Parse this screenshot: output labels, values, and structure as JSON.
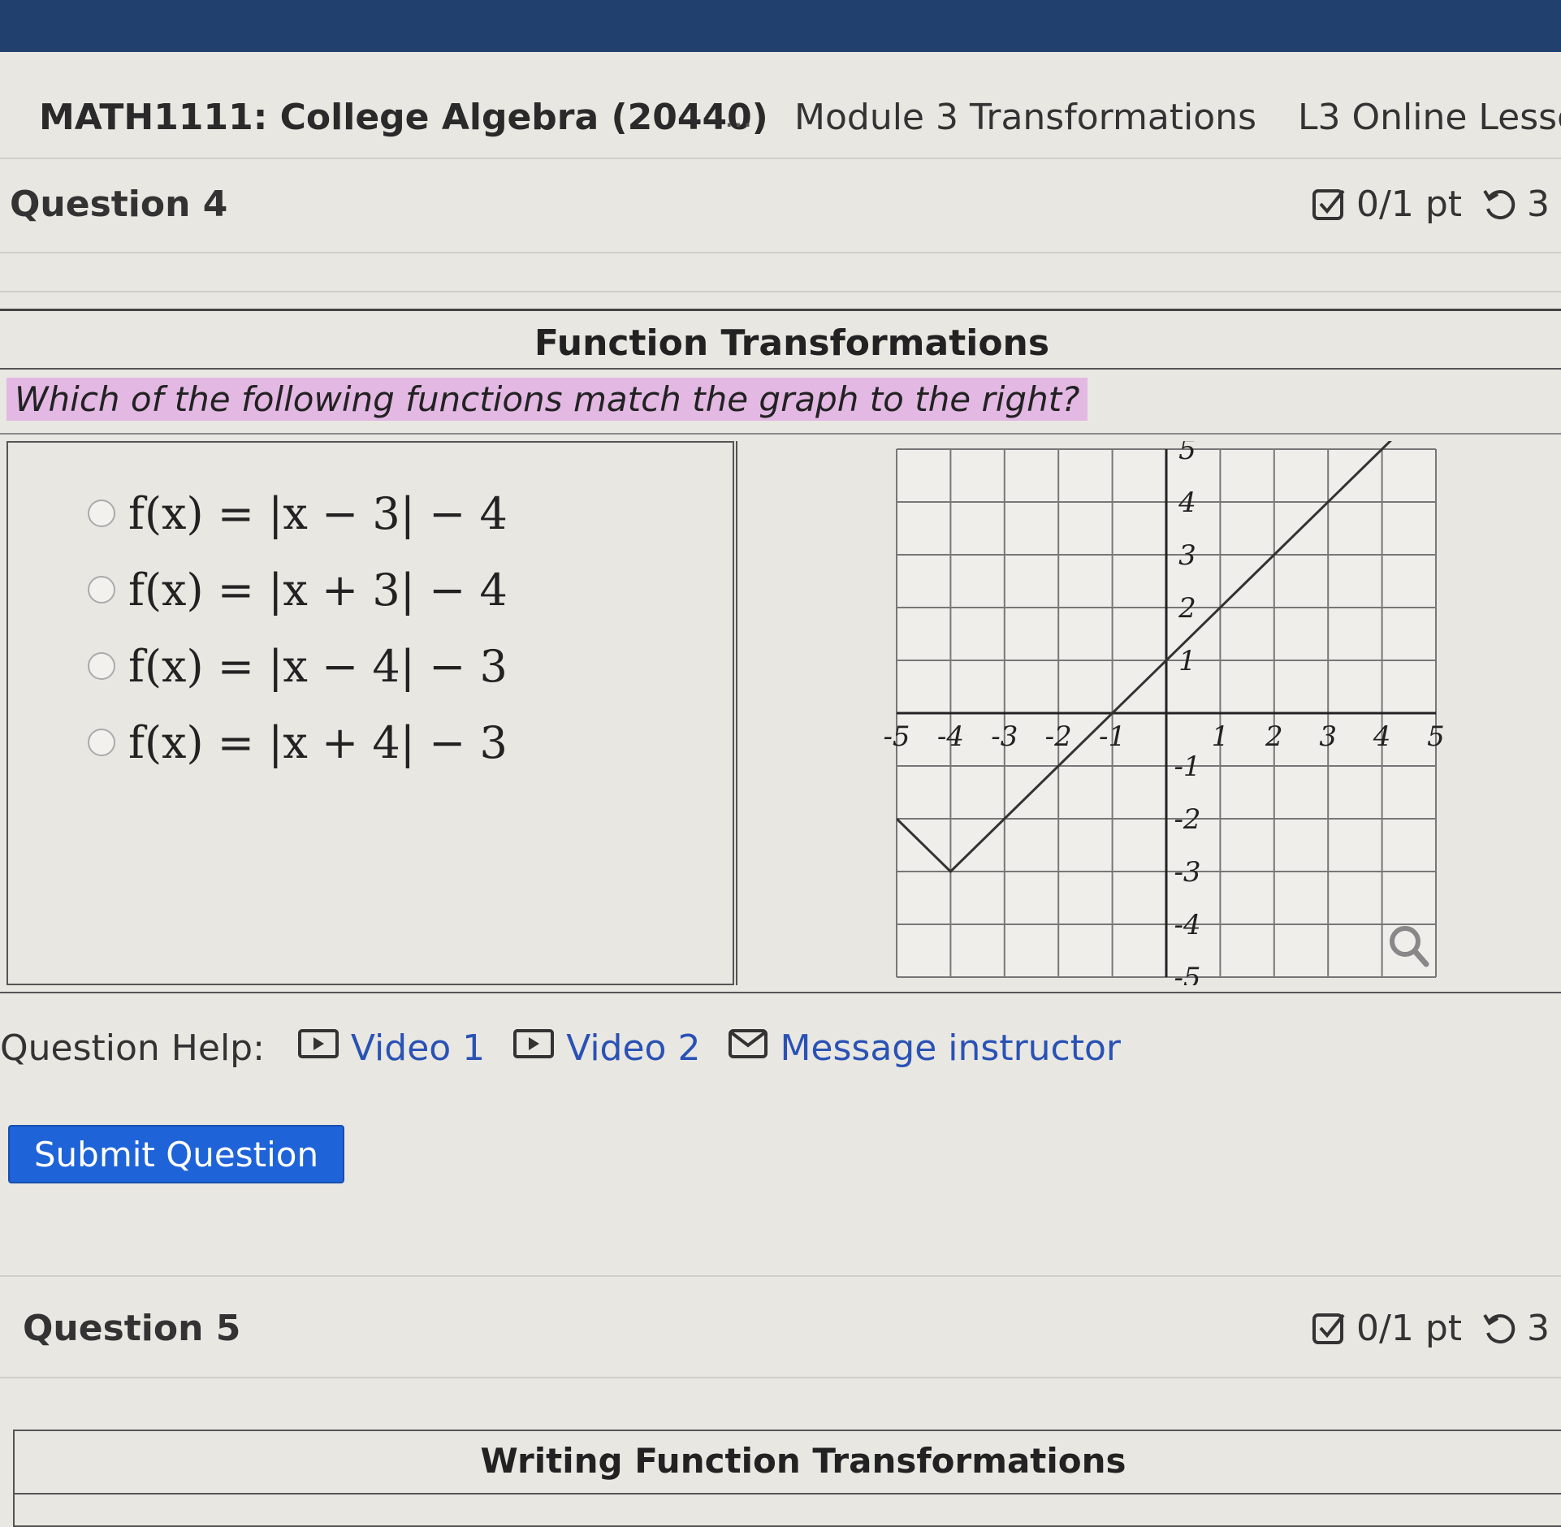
{
  "breadcrumb": {
    "course": "MATH1111: College Algebra (20440)",
    "ellipsis": "...",
    "module": "Module 3 Transformations",
    "lesson": "L3 Online Lesso"
  },
  "question4": {
    "title": "Question 4",
    "score": "0/1 pt",
    "attempts": "3",
    "box_title": "Function Transformations",
    "prompt": "Which of the following functions match the graph to the right?",
    "options": [
      "f(x) = |x − 3| − 4",
      "f(x) = |x + 3| − 4",
      "f(x) = |x − 4| − 3",
      "f(x) = |x + 4| − 3"
    ]
  },
  "help": {
    "label": "Question Help:",
    "video1": "Video 1",
    "video2": "Video 2",
    "message": "Message instructor"
  },
  "submit_label": "Submit Question",
  "question5": {
    "title": "Question 5",
    "score": "0/1 pt",
    "attempts": "3",
    "box_title": "Writing Function Transformations"
  },
  "colors": {
    "topbar": "#21406e",
    "prompt_highlight": "#e3b8e3",
    "link": "#2a52b5",
    "submit": "#1f63d9"
  },
  "chart_data": {
    "type": "line",
    "xlim": [
      -5,
      5
    ],
    "ylim": [
      -5,
      5
    ],
    "grid": true,
    "x_ticks": [
      -5,
      -4,
      -3,
      -2,
      -1,
      1,
      2,
      3,
      4,
      5
    ],
    "y_ticks": [
      5,
      4,
      3,
      2,
      1,
      -1,
      -2,
      -3,
      -4,
      -5
    ],
    "x_tick_labels": [
      "-5",
      "-4",
      "-3",
      "-2",
      "-1",
      "1",
      "2",
      "3",
      "4",
      "5"
    ],
    "y_tick_labels": [
      "5",
      "4",
      "3",
      "2",
      "1",
      "-1",
      "-2",
      "-3",
      "-4",
      "-5"
    ],
    "series": [
      {
        "points": [
          [
            -5,
            -2
          ],
          [
            -4,
            -3
          ],
          [
            1.5,
            2.5
          ],
          [
            5.3,
            6.3
          ]
        ]
      }
    ],
    "magnifier_icon": "magnifier-icon"
  }
}
